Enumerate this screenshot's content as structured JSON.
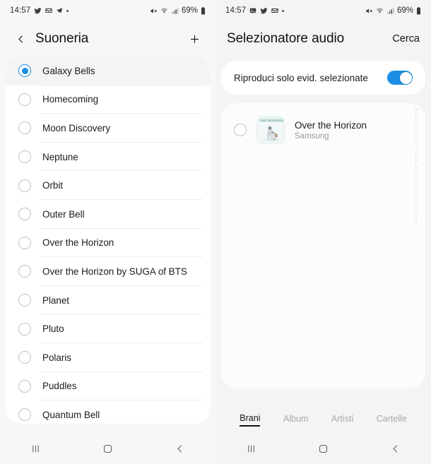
{
  "left": {
    "status": {
      "time": "14:57",
      "icons": [
        "twitter-icon",
        "mail-icon",
        "telegram-icon",
        "dot-icon"
      ],
      "right_icons": [
        "mute-icon",
        "wifi-icon",
        "signal-icon"
      ],
      "battery": "69%"
    },
    "appbar": {
      "back": "back-chevron",
      "title": "Suoneria",
      "add": "plus-icon"
    },
    "ringtones": [
      {
        "label": "Galaxy Bells",
        "selected": true
      },
      {
        "label": "Homecoming",
        "selected": false
      },
      {
        "label": "Moon Discovery",
        "selected": false
      },
      {
        "label": "Neptune",
        "selected": false
      },
      {
        "label": "Orbit",
        "selected": false
      },
      {
        "label": "Outer Bell",
        "selected": false
      },
      {
        "label": "Over the Horizon",
        "selected": false
      },
      {
        "label": "Over the Horizon by SUGA of BTS",
        "selected": false
      },
      {
        "label": "Planet",
        "selected": false
      },
      {
        "label": "Pluto",
        "selected": false
      },
      {
        "label": "Polaris",
        "selected": false
      },
      {
        "label": "Puddles",
        "selected": false
      },
      {
        "label": "Quantum Bell",
        "selected": false
      }
    ],
    "nav": [
      "recents-icon",
      "home-icon",
      "back-icon"
    ]
  },
  "right": {
    "status": {
      "time": "14:57",
      "icons": [
        "gallery-icon",
        "twitter-icon",
        "mail-icon",
        "dot-icon"
      ],
      "right_icons": [
        "mute-icon",
        "wifi-icon",
        "signal-icon"
      ],
      "battery": "69%"
    },
    "appbar": {
      "title": "Selezionatore audio",
      "action": "Cerca"
    },
    "toggle": {
      "label": "Riproduci solo evid. selezionate",
      "on": true
    },
    "songs": [
      {
        "title": "Over the Horizon",
        "artist": "Samsung",
        "selected": false,
        "art": "over-the-horizon-cover"
      }
    ],
    "index_letters": [
      "A",
      "B",
      "C",
      "D",
      "E",
      "F",
      "G",
      "H",
      "I",
      "J",
      "K",
      "L",
      "M",
      "N",
      "O",
      "P",
      "Q",
      "R",
      "S",
      "T",
      "U",
      "V",
      "W",
      "X",
      "Y",
      "Z",
      "#"
    ],
    "tabs": [
      {
        "label": "Brani",
        "active": true
      },
      {
        "label": "Album",
        "active": false
      },
      {
        "label": "Artisti",
        "active": false
      },
      {
        "label": "Cartelle",
        "active": false
      }
    ],
    "nav": [
      "recents-icon",
      "home-icon",
      "back-icon"
    ]
  },
  "colors": {
    "accent": "#1a8fe3",
    "text": "#1c1c1c",
    "muted": "#9a9a9a"
  }
}
